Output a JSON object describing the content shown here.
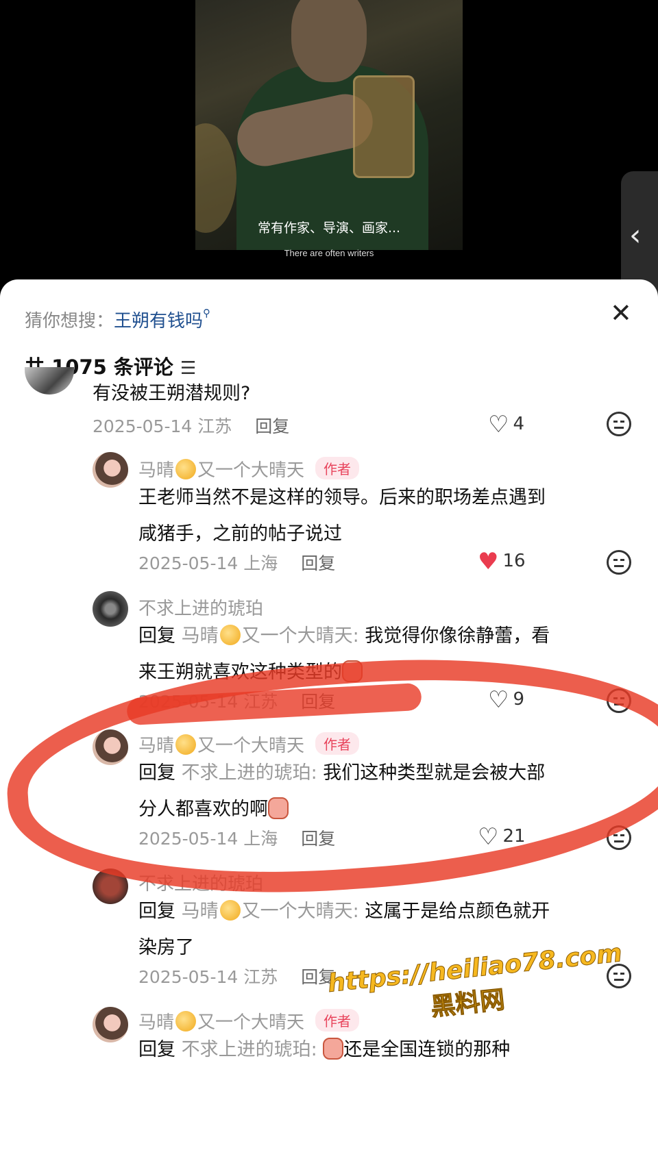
{
  "video": {
    "subtitle_zh": "常有作家、导演、画家...",
    "subtitle_en": "There are often writers"
  },
  "side_handle": {
    "icon": "chevron-left-icon",
    "glyph": "‹"
  },
  "sheet": {
    "suggest_label": "猜你想搜：",
    "suggest_query": "王朔有钱吗",
    "close_glyph": "✕",
    "count_text": "共 1075 条评论",
    "filter_glyph": "☰"
  },
  "comments": [
    {
      "text": "有没被王朔潜规则?",
      "date": "2025-05-14",
      "location": "江苏",
      "reply_label": "回复",
      "likes": "4"
    },
    {
      "user": "马晴",
      "user_suffix": "又一个大晴天",
      "badge": "作者",
      "text_line1": "王老师当然不是这样的领导。后来的职场差点遇到",
      "text_line2": "咸猪手，之前的帖子说过",
      "date": "2025-05-14",
      "location": "上海",
      "reply_label": "回复",
      "likes": "16"
    },
    {
      "user": "不求上进的琥珀",
      "reply_prefix": "回复",
      "mention": "马晴",
      "mention_suffix": "又一个大晴天:",
      "text_line1": "我觉得你像徐静蕾，看",
      "text_line2": "来王朔就喜欢这种类型的",
      "date": "2025-05-14",
      "location": "江苏",
      "reply_label": "回复",
      "likes": "9"
    },
    {
      "user": "马晴",
      "user_suffix": "又一个大晴天",
      "badge": "作者",
      "reply_prefix": "回复",
      "mention": "不求上进的琥珀:",
      "text_line1": "我们这种类型就是会被大部",
      "text_line2": "分人都喜欢的啊",
      "date": "2025-05-14",
      "location": "上海",
      "reply_label": "回复",
      "likes": "21"
    },
    {
      "user": "不求上进的琥珀",
      "reply_prefix": "回复",
      "mention": "马晴",
      "mention_suffix": "又一个大晴天:",
      "text_line1": "这属于是给点颜色就开",
      "text_line2": "染房了",
      "date": "2025-05-14",
      "location": "江苏",
      "reply_label": "回复"
    },
    {
      "user": "马晴",
      "user_suffix": "又一个大晴天",
      "badge": "作者",
      "reply_prefix": "回复",
      "mention": "不求上进的琥珀:",
      "text_line1": "还是全国连锁的那种"
    }
  ],
  "watermark": {
    "url": "https://heiliao78.com",
    "name": "黑料网"
  },
  "colors": {
    "accent_link": "#1f4f8f",
    "author_badge": "#e8445c",
    "liked_heart": "#ea3c4f",
    "annotation_red": "#e83a26",
    "watermark_gold": "#f6b820"
  }
}
